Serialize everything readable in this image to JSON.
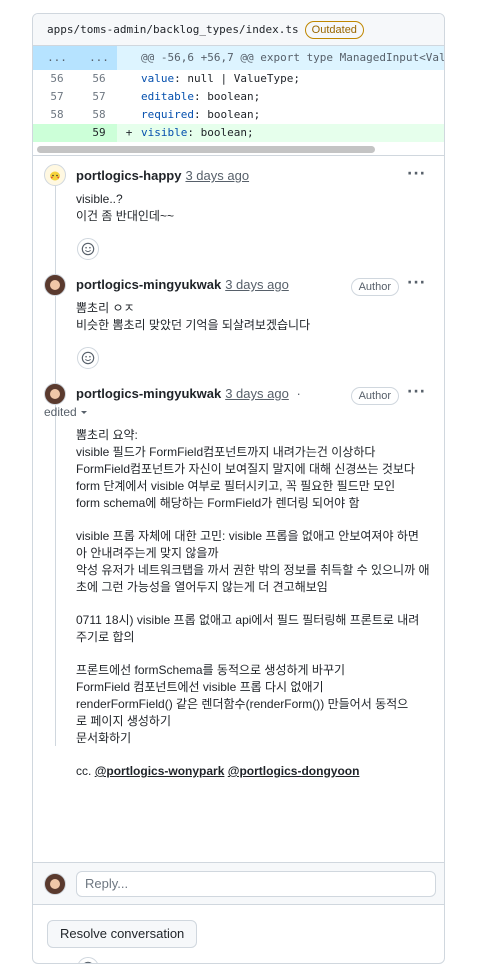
{
  "file": {
    "path": "apps/toms-admin/backlog_types/index.ts",
    "status_badge": "Outdated"
  },
  "diff": {
    "hunk": {
      "left": "...",
      "right": "...",
      "text": "@@ -56,6 +56,7 @@ export type ManagedInput<Valu"
    },
    "lines": [
      {
        "old": "56",
        "new": "56",
        "sign": "",
        "key": "value",
        "rest": ": null | ValueType;"
      },
      {
        "old": "57",
        "new": "57",
        "sign": "",
        "key": "editable",
        "rest": ": boolean;"
      },
      {
        "old": "58",
        "new": "58",
        "sign": "",
        "key": "required",
        "rest": ": boolean;"
      },
      {
        "old": "",
        "new": "59",
        "sign": "+",
        "key": "visible",
        "rest": ": boolean;"
      }
    ]
  },
  "comments": [
    {
      "author": "portlogics-happy",
      "time": "3 days ago",
      "lines": [
        "visible..?",
        "이건 좀 반대인데~~"
      ],
      "menu": "···"
    },
    {
      "author": "portlogics-mingyukwak",
      "time": "3 days ago",
      "badge": "Author",
      "lines": [
        "뽐초리 ㅇㅈ",
        "비슷한 뽐초리 맞았던 기억을 되살려보겠습니다"
      ],
      "menu": "···"
    },
    {
      "author": "portlogics-mingyukwak",
      "time": "3 days ago",
      "time_suffix": "·",
      "edited": "edited",
      "badge": "Author",
      "menu": "···",
      "paragraphs": [
        [
          "뽐초리 요약:",
          "visible 필드가 FormField컴포넌트까지 내려가는건 이상하다",
          "FormField컴포넌트가 자신이 보여질지 말지에 대해 신경쓰는 것보다",
          "form 단계에서 visible 여부로 필터시키고, 꼭 필요한 필드만 모인",
          "form schema에 해당하는 FormField가 렌더링 되어야 함"
        ],
        [
          "visible 프롭 자체에 대한 고민: visible 프롭을 없애고 안보여져야 하면",
          "아 안내려주는게 맞지 않을까",
          "악성 유저가 네트워크탭을 까서 권한 밖의 정보를 취득할 수 있으니까 애",
          "초에 그런 가능성을 열어두지 않는게 더 견고해보임"
        ],
        [
          "0711 18시) visible 프롭 없애고 api에서 필드 필터링해 프론트로 내려",
          "주기로 합의"
        ],
        [
          "프론트에선 formSchema를 동적으로 생성하게 바꾸기",
          "FormField 컴포넌트에선 visible 프롭 다시 없애기",
          "renderFormField() 같은 렌더함수(renderForm()) 만들어서 동적으",
          "로 페이지 생성하기",
          "문서화하기"
        ]
      ],
      "cc_prefix": "cc.",
      "mentions": [
        "@portlogics-wonypark",
        "@portlogics-dongyoon"
      ]
    }
  ],
  "reply": {
    "placeholder": "Reply..."
  },
  "resolve_label": "Resolve conversation"
}
